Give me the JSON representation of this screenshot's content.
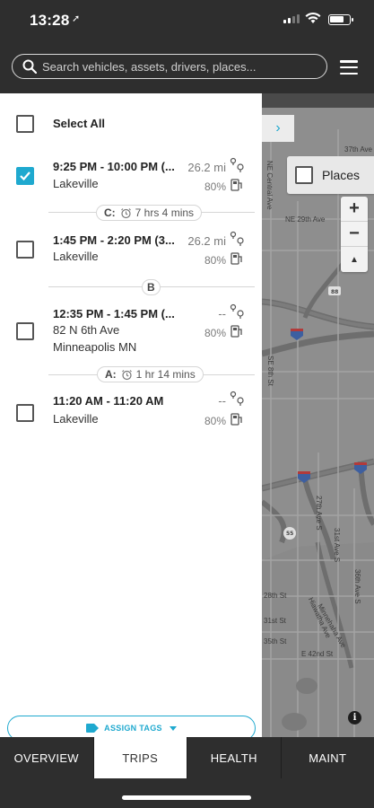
{
  "status_bar": {
    "time": "13:28",
    "location_arrow": "location-arrow-icon"
  },
  "header": {
    "search_placeholder": "Search vehicles, assets, drivers, places...",
    "menu_icon": "hamburger-menu-icon"
  },
  "panel": {
    "select_all_label": "Select All",
    "trips": [
      {
        "time_range": "9:25 PM - 10:00 PM (...",
        "place_line1": "Lakeville",
        "place_line2": "",
        "distance": "26.2 mi",
        "fuel": "80%",
        "checked": true
      },
      {
        "time_range": "1:45 PM - 2:20 PM (3...",
        "place_line1": "Lakeville",
        "place_line2": "",
        "distance": "26.2 mi",
        "fuel": "80%",
        "checked": false
      },
      {
        "time_range": "12:35 PM - 1:45 PM (...",
        "place_line1": "82 N 6th Ave",
        "place_line2": "Minneapolis MN",
        "distance": "--",
        "fuel": "80%",
        "checked": false
      },
      {
        "time_range": "11:20 AM - 11:20 AM",
        "place_line1": "Lakeville",
        "place_line2": "",
        "distance": "--",
        "fuel": "80%",
        "checked": false
      }
    ],
    "stops": [
      {
        "letter": "C:",
        "duration": "7 hrs 4 mins"
      },
      {
        "letter": "B",
        "duration": ""
      },
      {
        "letter": "A:",
        "duration": "1 hr 14 mins"
      }
    ],
    "assign_tags_label": "ASSIGN TAGS"
  },
  "map": {
    "places_label": "Places",
    "zoom_in": "+",
    "zoom_out": "−",
    "compass": "▲",
    "collapse_arrow": "›",
    "info": "i",
    "labels": [
      "37th Ave",
      "NE Central Ave",
      "NE 29th Ave",
      "SE 8th St",
      "27th Ave S",
      "31st Ave S",
      "36th Ave S",
      "Minnehaha Ave",
      "Hiawatha Ave",
      "E 42nd St",
      "28th St",
      "31st St",
      "35th St"
    ],
    "shields": [
      "88",
      "35W",
      "94",
      "94",
      "55"
    ]
  },
  "tabs": [
    {
      "label": "OVERVIEW",
      "active": false
    },
    {
      "label": "TRIPS",
      "active": true
    },
    {
      "label": "HEALTH",
      "active": false
    },
    {
      "label": "MAINT",
      "active": false
    }
  ],
  "colors": {
    "accent": "#1fa9cf",
    "dark": "#2e2e2e",
    "map": "#8f8f8f"
  }
}
